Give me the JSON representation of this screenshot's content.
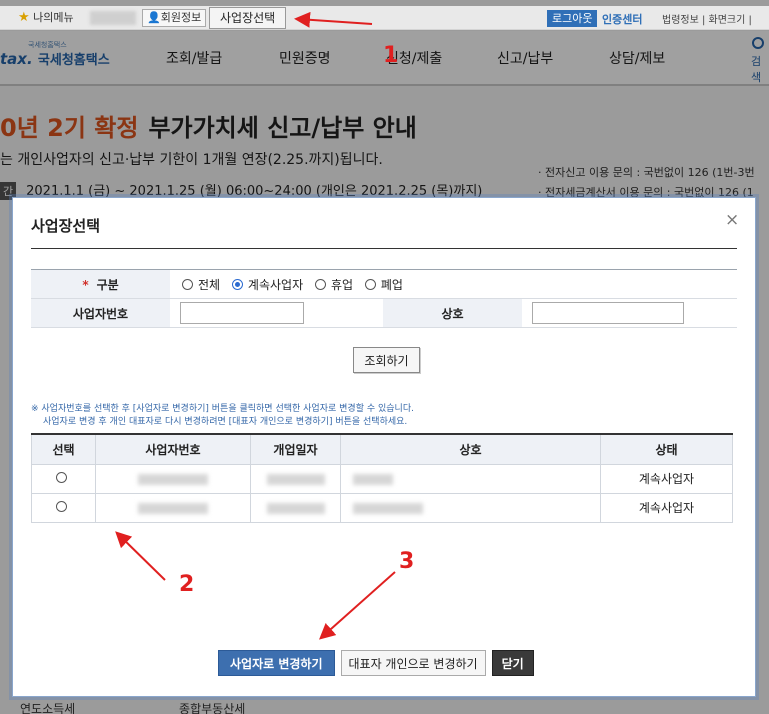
{
  "topbar": {
    "my_menu": "나의메뉴",
    "member_info": "회원정보",
    "business_select": "사업장선택",
    "logout": "로그아웃",
    "certificate_center": "인증센터",
    "right_links": "법령정보 | 화면크기 |"
  },
  "gnb": {
    "logo_small": "국세청홈택스",
    "logo_brand": "tax.",
    "logo_text": "국세청홈택스",
    "menu": [
      "조회/발급",
      "민원증명",
      "신청/제출",
      "신고/납부",
      "상담/제보"
    ],
    "search": "검색"
  },
  "banner": {
    "title_highlight": "0년 2기 확정",
    "title_rest": "부가가치세 신고/납부 안내",
    "subtitle": "는 개인사업자의 신고·납부 기한이 1개월 연장(2.25.까지)됩니다.",
    "date_tag": "간",
    "dates": "2021.1.1 (금) ~ 2021.1.25 (월) 06:00~24:00 (개인은 2021.2.25 (목)까지)",
    "right_line1": "· 전자신고 이용 문의 : 국번없이 126 (1번-3번",
    "right_line2": "· 전자세금계산서 이용 문의 : 국번없이 126 (1"
  },
  "bottom": {
    "item1": "연도소득세",
    "item2": "종합부동산세"
  },
  "modal": {
    "title": "사업장선택",
    "close": "×",
    "form": {
      "type_label": "구분",
      "type_options": [
        "전체",
        "계속사업자",
        "휴업",
        "폐업"
      ],
      "type_selected": "계속사업자",
      "bizno_label": "사업자번호",
      "name_label": "상호",
      "bizno_value": "",
      "name_value": ""
    },
    "search_button": "조회하기",
    "note_line1": "※ 사업자번호를 선택한 후 [사업자로 변경하기] 버튼을 클릭하면 선택한 사업자로 변경할 수 있습니다.",
    "note_line2": "사업자로 변경 후 개인 대표자로 다시 변경하려면 [대표자 개인으로 변경하기] 버튼을 선택하세요.",
    "table": {
      "headers": [
        "선택",
        "사업자번호",
        "개업일자",
        "상호",
        "상태"
      ],
      "rows": [
        {
          "status": "계속사업자"
        },
        {
          "status": "계속사업자"
        }
      ]
    },
    "buttons": {
      "change_to_business": "사업자로 변경하기",
      "change_to_personal": "대표자 개인으로 변경하기",
      "close": "닫기"
    }
  },
  "annotations": {
    "labels": [
      "1",
      "2",
      "3"
    ],
    "color": "#e02020"
  }
}
